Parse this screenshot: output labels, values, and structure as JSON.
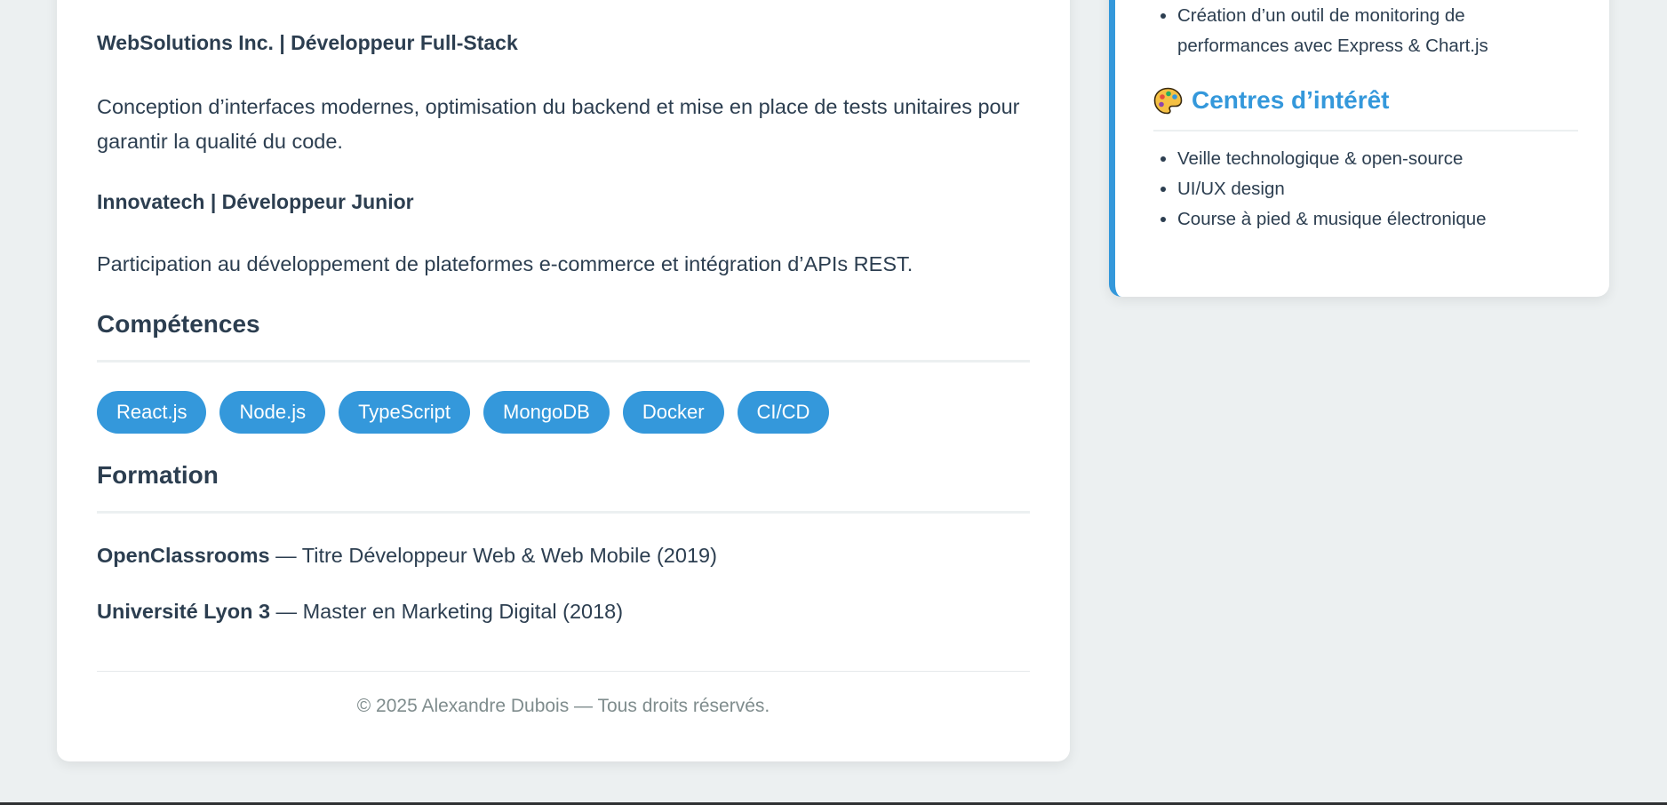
{
  "experience": {
    "jobs": [
      {
        "company": "WebSolutions Inc.",
        "separator": "|",
        "role": "Développeur Full-Stack",
        "description": "Conception d’interfaces modernes, optimisation du backend et mise en place de tests unitaires pour garantir la qualité du code."
      },
      {
        "company": "Innovatech",
        "separator": "|",
        "role": "Développeur Junior",
        "description": "Participation au développement de plateformes e-commerce et intégration d’APIs REST."
      }
    ]
  },
  "skills": {
    "heading": "Compétences",
    "tags": [
      "React.js",
      "Node.js",
      "TypeScript",
      "MongoDB",
      "Docker",
      "CI/CD"
    ],
    "tag_color": "#3498db"
  },
  "education": {
    "heading": "Formation",
    "items": [
      {
        "school": "OpenClassrooms",
        "dash": " — ",
        "detail": "Titre Développeur Web & Web Mobile (2019)"
      },
      {
        "school": "Université Lyon 3",
        "dash": " — ",
        "detail": "Master en Marketing Digital (2018)"
      }
    ]
  },
  "footer": {
    "text": "© 2025 Alexandre Dubois — Tous droits réservés."
  },
  "sidebar": {
    "projects_tail": {
      "items": [
        "Création d’un outil de monitoring de performances avec Express & Chart.js"
      ]
    },
    "interests": {
      "icon": "palette-icon",
      "heading": "Centres d’intérêt",
      "items": [
        "Veille technologique & open-source",
        "UI/UX design",
        "Course à pied & musique électronique"
      ]
    },
    "accent_color": "#3498db"
  },
  "colors": {
    "page_background": "#ecf0f1",
    "text": "#2c3e50",
    "muted": "#7f8c8d",
    "accent": "#3498db"
  }
}
